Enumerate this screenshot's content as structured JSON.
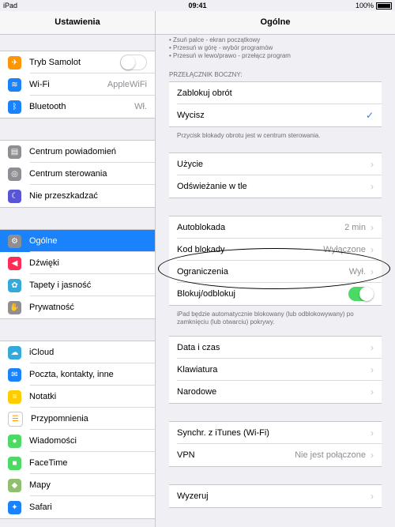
{
  "status": {
    "device": "iPad",
    "time": "09:41",
    "battery": "100%"
  },
  "sidebar": {
    "title": "Ustawienia",
    "groups": [
      [
        {
          "label": "Tryb Samolot",
          "icon": "airplane-icon",
          "color": "#ff9500",
          "type": "switch",
          "on": false
        },
        {
          "label": "Wi-Fi",
          "value": "AppleWiFi",
          "icon": "wifi-icon",
          "color": "#1a82fb"
        },
        {
          "label": "Bluetooth",
          "value": "Wł.",
          "icon": "bluetooth-icon",
          "color": "#1a82fb"
        }
      ],
      [
        {
          "label": "Centrum powiadomień",
          "icon": "notification-center-icon",
          "color": "#8e8e93"
        },
        {
          "label": "Centrum sterowania",
          "icon": "control-center-icon",
          "color": "#8e8e93"
        },
        {
          "label": "Nie przeszkadzać",
          "icon": "moon-icon",
          "color": "#5856d6"
        }
      ],
      [
        {
          "label": "Ogólne",
          "icon": "gear-icon",
          "color": "#8e8e93",
          "active": true
        },
        {
          "label": "Dźwięki",
          "icon": "speaker-icon",
          "color": "#ff2d55"
        },
        {
          "label": "Tapety i jasność",
          "icon": "flower-icon",
          "color": "#34aadc"
        },
        {
          "label": "Prywatność",
          "icon": "hand-icon",
          "color": "#8e8e93"
        }
      ],
      [
        {
          "label": "iCloud",
          "icon": "cloud-icon",
          "color": "#34aadc"
        },
        {
          "label": "Poczta, kontakty, inne",
          "icon": "mail-icon",
          "color": "#1a82fb"
        },
        {
          "label": "Notatki",
          "icon": "notes-icon",
          "color": "#ffcc00"
        },
        {
          "label": "Przypomnienia",
          "icon": "reminders-icon",
          "color": "#ffffff"
        },
        {
          "label": "Wiadomości",
          "icon": "messages-icon",
          "color": "#4cd964"
        },
        {
          "label": "FaceTime",
          "icon": "facetime-icon",
          "color": "#4cd964"
        },
        {
          "label": "Mapy",
          "icon": "maps-icon",
          "color": "#8fbf6f"
        },
        {
          "label": "Safari",
          "icon": "safari-icon",
          "color": "#1a82fb"
        }
      ]
    ]
  },
  "main": {
    "title": "Ogólne",
    "hints": [
      "• Zsuń palce - ekran początkowy",
      "• Przesuń w górę - wybór programów",
      "• Przesuń w lewo/prawo - przełącz program"
    ],
    "side_switch_header": "PRZEŁĄCZNIK BOCZNY:",
    "side_switch": [
      {
        "label": "Zablokuj obrót"
      },
      {
        "label": "Wycisz",
        "check": true
      }
    ],
    "side_switch_footer": "Przycisk blokady obrotu jest w centrum sterowania.",
    "group_usage": [
      {
        "label": "Użycie"
      },
      {
        "label": "Odświeżanie w tle"
      }
    ],
    "group_lock": [
      {
        "label": "Autoblokada",
        "value": "2 min"
      },
      {
        "label": "Kod blokady",
        "value": "Wyłączone"
      },
      {
        "label": "Ograniczenia",
        "value": "Wył."
      },
      {
        "label": "Blokuj/odblokuj",
        "toggle": true
      }
    ],
    "lock_footer": "iPad będzie automatycznie blokowany (lub odblokowywany) po zamknięciu (lub otwarciu) pokrywy.",
    "group_locale": [
      {
        "label": "Data i czas"
      },
      {
        "label": "Klawiatura"
      },
      {
        "label": "Narodowe"
      }
    ],
    "group_sync": [
      {
        "label": "Synchr. z iTunes (Wi-Fi)"
      },
      {
        "label": "VPN",
        "value": "Nie jest połączone"
      }
    ],
    "group_reset": [
      {
        "label": "Wyzeruj"
      }
    ]
  },
  "glyphs": {
    "chevron": "›",
    "check": "✓"
  }
}
